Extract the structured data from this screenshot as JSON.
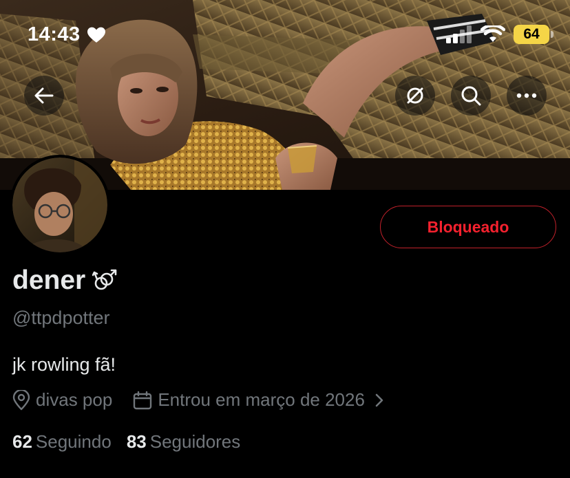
{
  "status_bar": {
    "time": "14:43",
    "battery": "64"
  },
  "banner": {
    "nav_icons": [
      "back-arrow-icon",
      "translate-slash-icon",
      "search-icon",
      "more-icon"
    ]
  },
  "profile": {
    "display_name": "dener",
    "name_emoji": "⚣",
    "handle": "@ttpdpotter",
    "bio": "jk rowling fã!",
    "location": "divas pop",
    "joined": "Entrou em março de 2026",
    "following_count": "62",
    "following_label": "Seguindo",
    "followers_count": "83",
    "followers_label": "Seguidores",
    "action_button": "Bloqueado"
  },
  "colors": {
    "background": "#000000",
    "text_primary": "#e7e9ea",
    "text_secondary": "#71767b",
    "blocked_red": "#f4212e",
    "battery_yellow": "#f5d547"
  }
}
